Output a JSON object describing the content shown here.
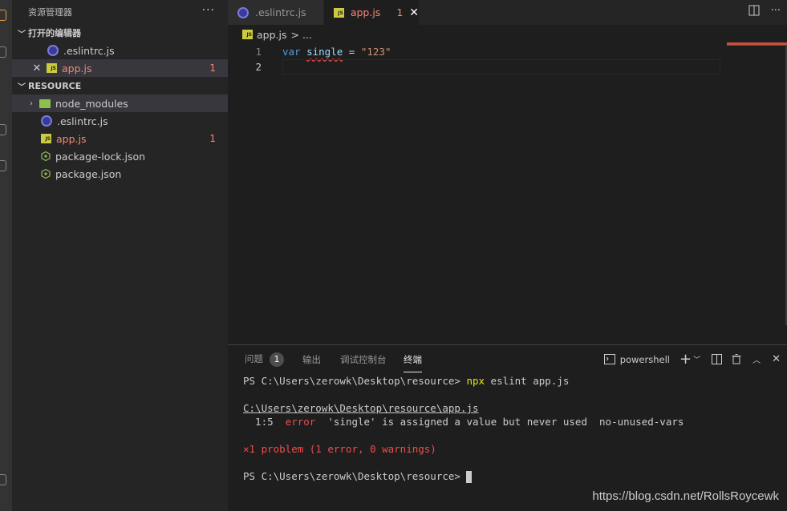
{
  "sidebar": {
    "title": "资源管理器",
    "more": "···",
    "open_editors_label": "打开的编辑器",
    "open_editors": [
      {
        "name": ".eslintrc.js",
        "icon": "eslint-icon"
      },
      {
        "name": "app.js",
        "icon": "js-icon",
        "badge": "1"
      }
    ],
    "folder_label": "RESOURCE",
    "files": [
      {
        "name": "node_modules",
        "icon": "folder-icon"
      },
      {
        "name": ".eslintrc.js",
        "icon": "eslint-icon"
      },
      {
        "name": "app.js",
        "icon": "js-icon",
        "badge": "1"
      },
      {
        "name": "package-lock.json",
        "icon": "json-icon"
      },
      {
        "name": "package.json",
        "icon": "json-icon"
      }
    ]
  },
  "tabs": [
    {
      "label": ".eslintrc.js"
    },
    {
      "label": "app.js",
      "badge": "1"
    }
  ],
  "breadcrumb": {
    "file": "app.js",
    "rest": "> ..."
  },
  "code": {
    "line_numbers": [
      "1",
      "2"
    ],
    "kw": "var",
    "ident": "single",
    "op": " = ",
    "str": "\"123\""
  },
  "panel": {
    "tabs": [
      {
        "label": "问题",
        "badge": "1"
      },
      {
        "label": "输出"
      },
      {
        "label": "调试控制台"
      },
      {
        "label": "终端"
      }
    ],
    "shell": "powershell"
  },
  "terminal": {
    "prompt": "PS C:\\Users\\zerowk\\Desktop\\resource> ",
    "cmd_npx": "npx",
    "cmd_rest": " eslint app.js",
    "file_path": "C:\\Users\\zerowk\\Desktop\\resource\\app.js",
    "pos": "  1:5  ",
    "level": "error",
    "message": "  'single' is assigned a value but never used  no-unused-vars",
    "summary": "✕1 problem (1 error, 0 warnings)",
    "prompt2": "PS C:\\Users\\zerowk\\Desktop\\resource> "
  },
  "watermark": "https://blog.csdn.net/RollsRoycewk",
  "colors": {
    "error": "#f48771",
    "keyword": "#569cd6",
    "string": "#ce9178",
    "js_icon": "#cbcb41"
  }
}
